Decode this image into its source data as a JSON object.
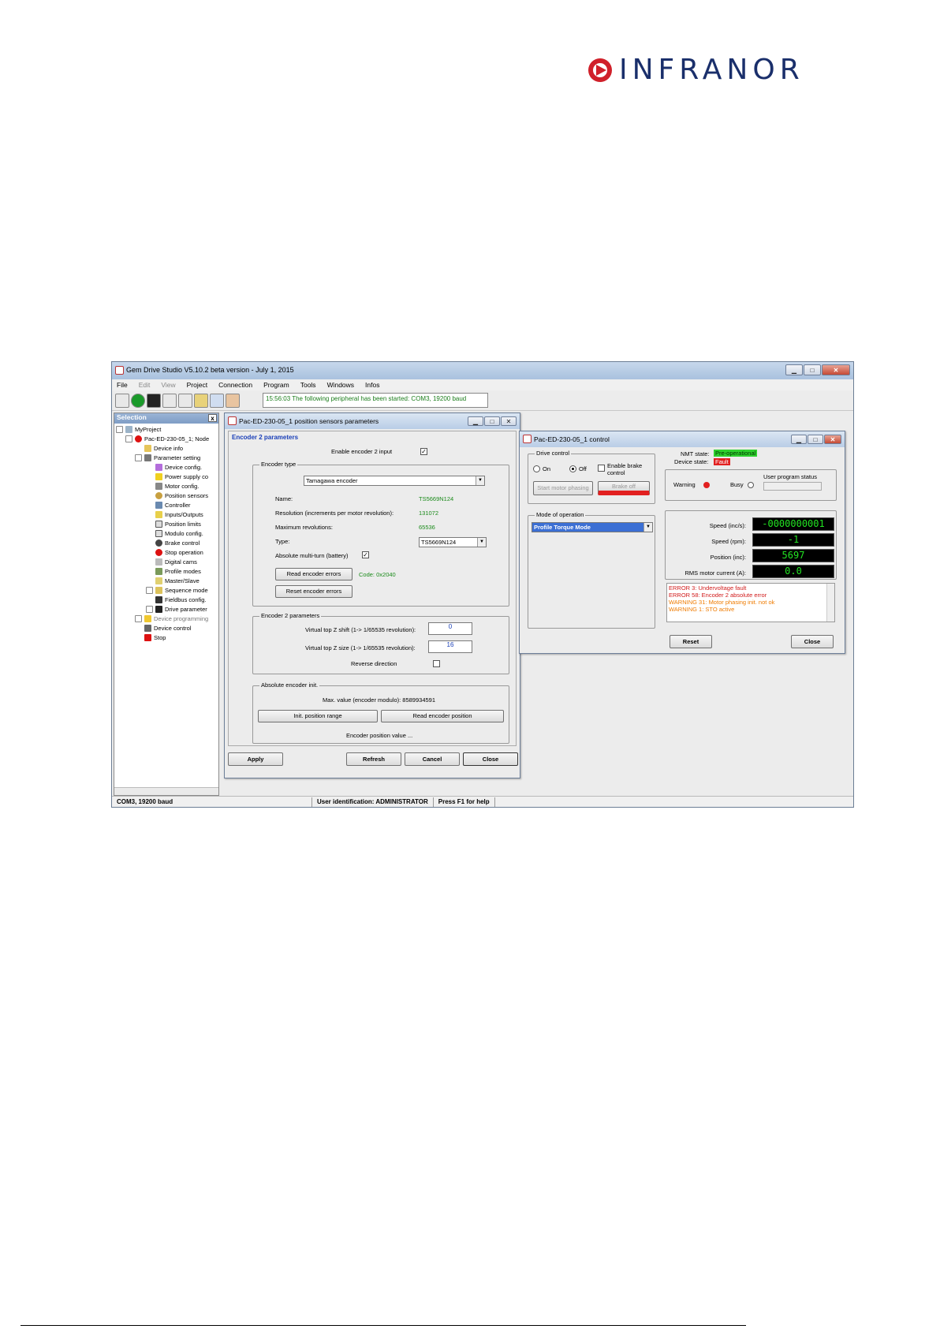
{
  "logo": {
    "text": "INFRANOR"
  },
  "app": {
    "title": "Gem Drive Studio  V5.10.2 beta version - July 1, 2015",
    "menu": [
      "File",
      "Edit",
      "View",
      "Project",
      "Connection",
      "Program",
      "Tools",
      "Windows",
      "Infos"
    ],
    "status_message": "15:56:03 The following peripheral has been started: COM3, 19200 baud",
    "selection": {
      "header": "Selection",
      "close": "x",
      "items": [
        "MyProject",
        "Pac-ED-230-05_1; Node",
        "Device info",
        "Parameter setting",
        "Device config.",
        "Power supply co",
        "Motor config.",
        "Position sensors",
        "Controller",
        "Inputs/Outputs",
        "Position limits",
        "Modulo config.",
        "Brake control",
        "Stop operation",
        "Digital cams",
        "Profile modes",
        "Master/Slave",
        "Sequence mode",
        "Fieldbus config.",
        "Drive parameter",
        "Device programming",
        "Device control",
        "Stop"
      ]
    },
    "statusbar": [
      "COM3, 19200 baud",
      "User identification: ADMINISTRATOR",
      "Press F1 for help"
    ]
  },
  "sensors_dialog": {
    "title": "Pac-ED-230-05_1 position sensors parameters",
    "section": "Encoder 2 parameters",
    "enable_label": "Enable encoder 2 input",
    "encoder_type": {
      "group": "Encoder type",
      "selected": "Tamagawa encoder",
      "name_label": "Name:",
      "name_value": "TS5669N124",
      "resolution_label": "Resolution (increments per motor revolution):",
      "resolution_value": "131072",
      "maxrev_label": "Maximum revolutions:",
      "maxrev_value": "65536",
      "type_label": "Type:",
      "type_value": "TS5669N124",
      "absolute_label": "Absolute multi-turn (battery)",
      "read_errors_btn": "Read encoder errors",
      "code_label": "Code: 0x2040",
      "reset_errors_btn": "Reset encoder errors"
    },
    "enc2_params": {
      "group": "Encoder 2 parameters",
      "shift_label": "Virtual top Z shift (1-> 1/65535 revolution):",
      "shift_value": "0",
      "size_label": "Virtual top Z size (1-> 1/65535 revolution):",
      "size_value": "16",
      "reverse_label": "Reverse direction"
    },
    "abs_init": {
      "group": "Absolute encoder init.",
      "max_value": "Max. value (encoder modulo): 8589934591",
      "init_btn": "Init. position range",
      "read_btn": "Read encoder position",
      "pos_value": "Encoder position value ..."
    },
    "buttons": {
      "apply": "Apply",
      "refresh": "Refresh",
      "cancel": "Cancel",
      "close": "Close"
    }
  },
  "control_dialog": {
    "title": "Pac-ED-230-05_1 control",
    "drive_control": {
      "group": "Drive control",
      "on": "On",
      "off": "Off",
      "enable_brake": "Enable brake control",
      "start_phasing": "Start motor phasing",
      "brake_off": "Brake off"
    },
    "nmt_label": "NMT state:",
    "nmt_value": "Pre-operational",
    "device_label": "Device state:",
    "device_value": "Fault",
    "warning_label": "Warning",
    "busy_label": "Busy",
    "user_prog_label": "User program status",
    "mode": {
      "group": "Mode of operation",
      "value": "Profile Torque Mode"
    },
    "readouts": [
      {
        "label": "Speed (inc/s):",
        "value": "-0000000001"
      },
      {
        "label": "Speed (rpm):",
        "value": "-1"
      },
      {
        "label": "Position (inc):",
        "value": "5697"
      },
      {
        "label": "RMS motor current (A):",
        "value": "0.0"
      }
    ],
    "messages": [
      {
        "text": "ERROR 3: Undervoltage fault",
        "color": "#d11a1a"
      },
      {
        "text": "ERROR 58: Encoder 2 absolute error",
        "color": "#d11a1a"
      },
      {
        "text": "WARNING 31: Motor phasing init. not ok",
        "color": "#ef7b00"
      },
      {
        "text": "WARNING 1: STO active",
        "color": "#ef7b00"
      }
    ],
    "reset_btn": "Reset",
    "close_btn": "Close"
  }
}
